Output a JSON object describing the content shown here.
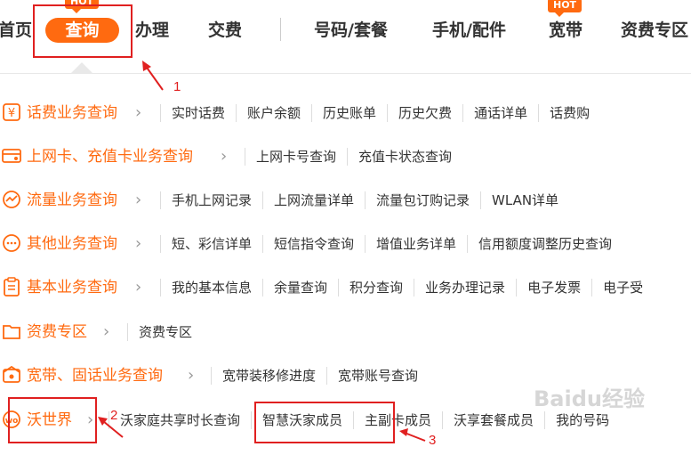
{
  "nav": {
    "items": [
      {
        "label": "首页"
      },
      {
        "label": "查询"
      },
      {
        "label": "办理"
      },
      {
        "label": "交费"
      },
      {
        "label": "号码/套餐"
      },
      {
        "label": "手机/配件"
      },
      {
        "label": "宽带"
      },
      {
        "label": "资费专区"
      }
    ],
    "hot_badge": "HOT",
    "accent": "#ff6a10"
  },
  "categories": [
    {
      "title": "话费业务查询",
      "icon": "yuan-icon",
      "links": [
        "实时话费",
        "账户余额",
        "历史账单",
        "历史欠费",
        "通话详单",
        "话费购"
      ]
    },
    {
      "title": "上网卡、充值卡业务查询",
      "icon": "card-icon",
      "links": [
        "上网卡号查询",
        "充值卡状态查询"
      ]
    },
    {
      "title": "流量业务查询",
      "icon": "traffic-icon",
      "links": [
        "手机上网记录",
        "上网流量详单",
        "流量包订购记录",
        "WLAN详单"
      ]
    },
    {
      "title": "其他业务查询",
      "icon": "chat-icon",
      "links": [
        "短、彩信详单",
        "短信指令查询",
        "增值业务详单",
        "信用额度调整历史查询"
      ]
    },
    {
      "title": "基本业务查询",
      "icon": "clipboard-icon",
      "links": [
        "我的基本信息",
        "余量查询",
        "积分查询",
        "业务办理记录",
        "电子发票",
        "电子受"
      ]
    },
    {
      "title": "资费专区",
      "icon": "folder-icon",
      "links": [
        "资费专区"
      ]
    },
    {
      "title": "宽带、固话业务查询",
      "icon": "broadband-icon",
      "links": [
        "宽带装移修进度",
        "宽带账号查询"
      ]
    },
    {
      "title": "沃世界",
      "icon": "wo-icon",
      "links": [
        "沃家庭共享时长查询",
        "智慧沃家成员",
        "主副卡成员",
        "沃享套餐成员",
        "我的号码"
      ]
    }
  ],
  "annotations": [
    "1",
    "2",
    "3"
  ],
  "watermark": "Baidu经验"
}
